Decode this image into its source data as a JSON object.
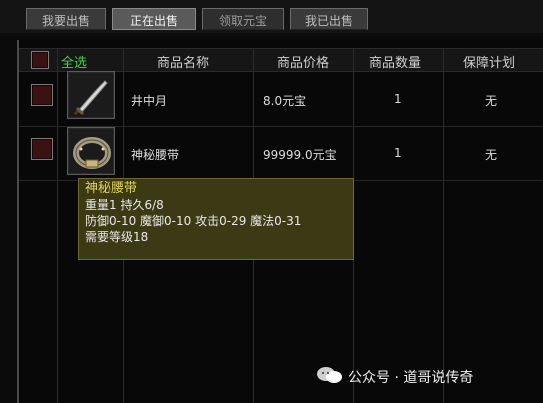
{
  "tabs": [
    {
      "label": "我要出售",
      "state": "normal"
    },
    {
      "label": "正在出售",
      "state": "active"
    },
    {
      "label": "领取元宝",
      "state": "dim"
    },
    {
      "label": "我已出售",
      "state": "normal"
    }
  ],
  "table": {
    "select_all": "全选",
    "columns": [
      "商品名称",
      "商品价格",
      "商品数量",
      "保障计划"
    ],
    "rows": [
      {
        "icon": "sword-icon",
        "name": "井中月",
        "price": "8.0元宝",
        "quantity": "1",
        "plan": "无"
      },
      {
        "icon": "belt-icon",
        "name": "神秘腰带",
        "price": "99999.0元宝",
        "quantity": "1",
        "plan": "无"
      }
    ]
  },
  "tooltip": {
    "title": "神秘腰带",
    "lines": [
      "重量1 持久6/8",
      "防御0-10 魔御0-10 攻击0-29 魔法0-31",
      "需要等级18"
    ]
  },
  "watermark": {
    "text": "公众号 · 道哥说传奇"
  },
  "colors": {
    "select_all": "#3bd94a",
    "checkbox_fill": "#3b1212",
    "tooltip_bg": "#3c3a14",
    "tooltip_title": "#e0cf5a"
  }
}
